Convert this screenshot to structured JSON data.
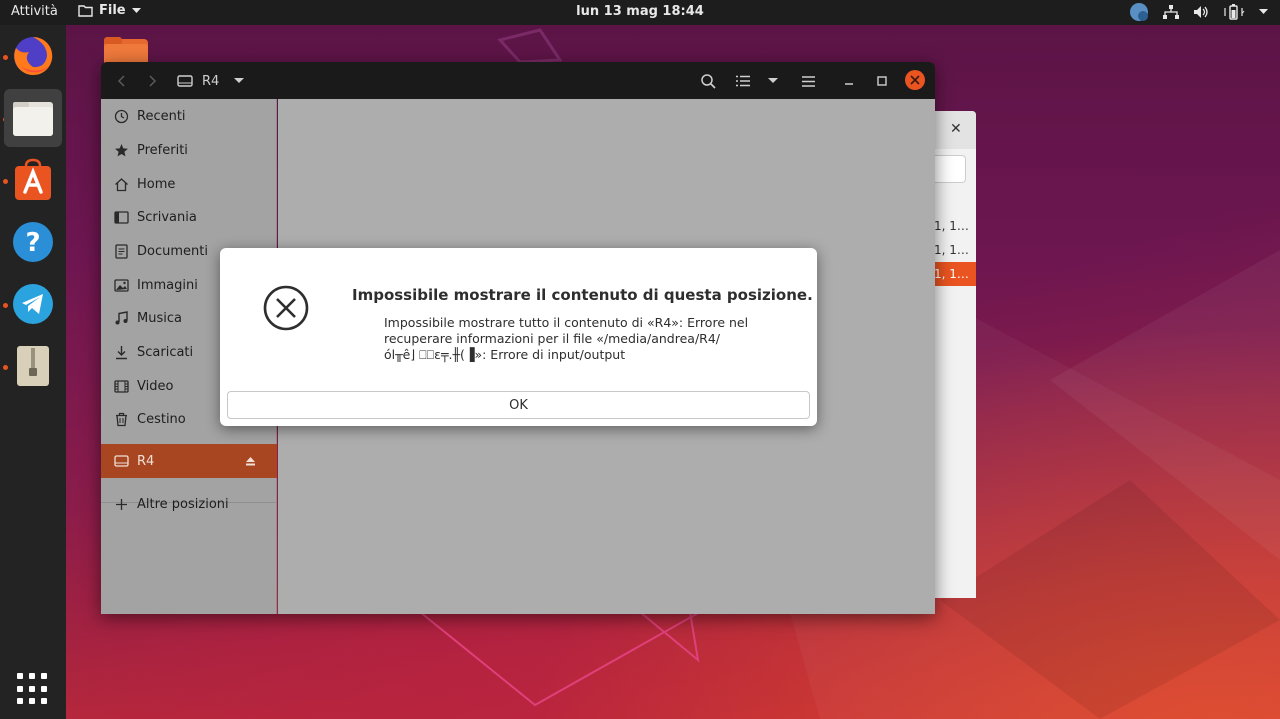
{
  "topbar": {
    "activities": "Attività",
    "app_menu": "File",
    "clock": "lun 13 mag  18:44",
    "tray": [
      "updates-icon",
      "network-icon",
      "volume-icon",
      "battery-icon"
    ]
  },
  "dock": {
    "items": [
      {
        "name": "firefox",
        "running": true
      },
      {
        "name": "files",
        "running": true,
        "active": true
      },
      {
        "name": "software",
        "running": true
      },
      {
        "name": "help",
        "running": false
      },
      {
        "name": "telegram",
        "running": true
      },
      {
        "name": "archive",
        "running": true
      }
    ]
  },
  "background_window": {
    "rows": [
      "1, 1…",
      "1, 1…",
      "1, 1…"
    ],
    "selected_row": 2
  },
  "window": {
    "location": "R4",
    "sidebar": {
      "places": [
        {
          "label": "Recenti",
          "icon": "clock-icon"
        },
        {
          "label": "Preferiti",
          "icon": "star-icon"
        },
        {
          "label": "Home",
          "icon": "home-icon"
        },
        {
          "label": "Scrivania",
          "icon": "desktop-icon"
        },
        {
          "label": "Documenti",
          "icon": "document-icon"
        },
        {
          "label": "Immagini",
          "icon": "image-icon"
        },
        {
          "label": "Musica",
          "icon": "music-icon"
        },
        {
          "label": "Scaricati",
          "icon": "download-icon"
        },
        {
          "label": "Video",
          "icon": "video-icon"
        },
        {
          "label": "Cestino",
          "icon": "trash-icon"
        }
      ],
      "device": {
        "label": "R4",
        "icon": "drive-icon"
      },
      "other": {
        "label": "Altre posizioni",
        "icon": "plus-icon"
      }
    }
  },
  "dialog": {
    "title": "Impossibile mostrare il contenuto di questa posizione.",
    "message_lines": [
      "Impossibile mostrare tutto il contenuto di «R4»: Errore nel",
      "recuperare informazioni per il file «/media/andrea/R4/",
      "ól╥ê⌋ ⎕⎕ε╤.╫(▐»: Errore di input/output"
    ],
    "ok_label": "OK"
  },
  "colors": {
    "accent": "#e95420",
    "sidebar_selected": "#a84621",
    "topbar": "#1d1d1d",
    "dock": "#232323"
  }
}
